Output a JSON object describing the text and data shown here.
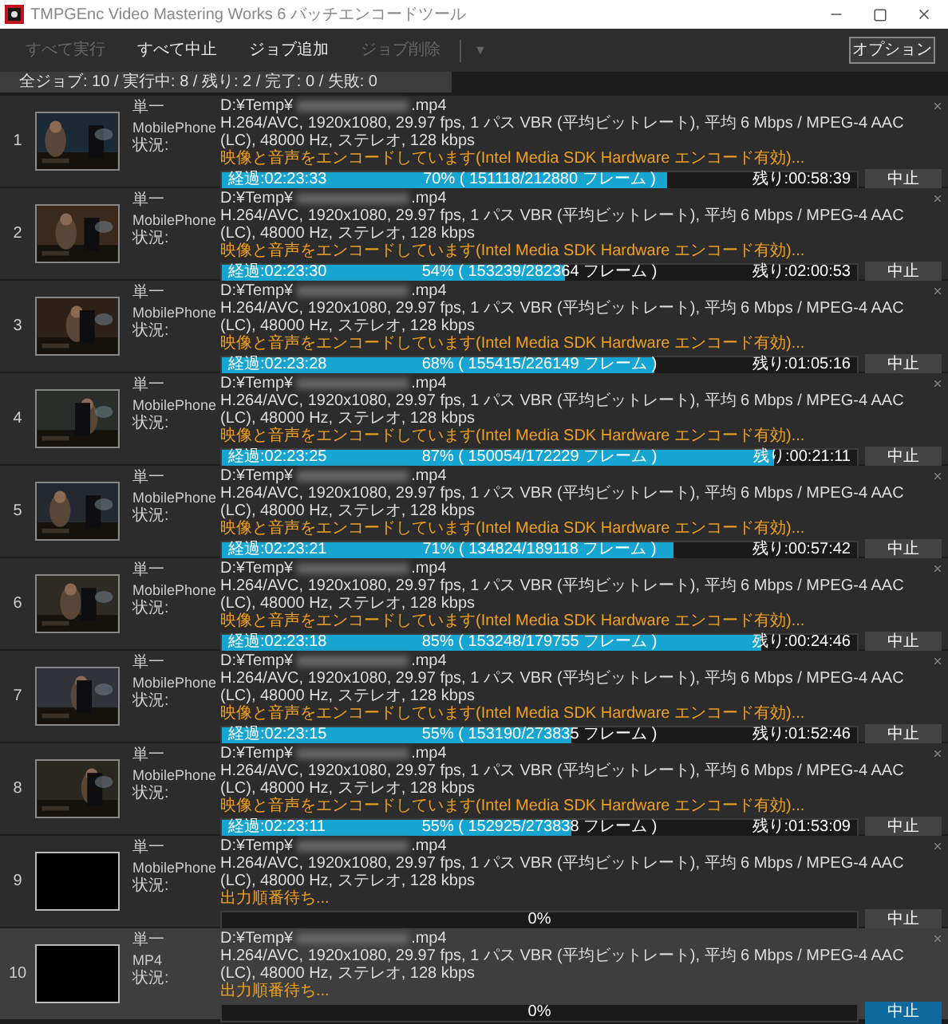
{
  "window": {
    "title": "TMPGEnc Video Mastering Works 6 バッチエンコードツール"
  },
  "toolbar": {
    "buttons": [
      {
        "label": "すべて実行",
        "disabled": true
      },
      {
        "label": "すべて中止",
        "disabled": false
      },
      {
        "label": "ジョブ追加",
        "disabled": false
      },
      {
        "label": "ジョブ削除",
        "disabled": true
      }
    ],
    "dropdown": {
      "label": "▼",
      "disabled": true
    },
    "options_button": "オプション"
  },
  "summary": "全ジョブ: 10 / 実行中: 8 / 残り: 2 / 完了: 0 / 失敗: 0",
  "jobs": [
    {
      "number": "1",
      "has_thumbnail": true,
      "mode": "単一",
      "format": "MobilePhone",
      "status_label": "状況:",
      "path_prefix": "D:¥Temp¥",
      "path_suffix": ".mp4",
      "spec": "H.264/AVC, 1920x1080, 29.97 fps, 1 パス VBR (平均ビットレート), 平均 6 Mbps / MPEG-4 AAC (LC), 48000 Hz, ステレオ, 128 kbps",
      "status": "映像と音声をエンコードしています(Intel Media SDK Hardware エンコード有効)...",
      "elapsed": "経過:02:23:33",
      "progress": "70% ( 151118/212880 フレーム )",
      "level": 0.7,
      "remaining": "残り:00:58:39",
      "stop": "中止",
      "selected": false
    },
    {
      "number": "2",
      "has_thumbnail": true,
      "mode": "単一",
      "format": "MobilePhone",
      "status_label": "状況:",
      "path_prefix": "D:¥Temp¥",
      "path_suffix": ".mp4",
      "spec": "H.264/AVC, 1920x1080, 29.97 fps, 1 パス VBR (平均ビットレート), 平均 6 Mbps / MPEG-4 AAC (LC), 48000 Hz, ステレオ, 128 kbps",
      "status": "映像と音声をエンコードしています(Intel Media SDK Hardware エンコード有効)...",
      "elapsed": "経過:02:23:30",
      "progress": "54% ( 153239/282364 フレーム )",
      "level": 0.54,
      "remaining": "残り:02:00:53",
      "stop": "中止",
      "selected": false
    },
    {
      "number": "3",
      "has_thumbnail": true,
      "mode": "単一",
      "format": "MobilePhone",
      "status_label": "状況:",
      "path_prefix": "D:¥Temp¥",
      "path_suffix": ".mp4",
      "spec": "H.264/AVC, 1920x1080, 29.97 fps, 1 パス VBR (平均ビットレート), 平均 6 Mbps / MPEG-4 AAC (LC), 48000 Hz, ステレオ, 128 kbps",
      "status": "映像と音声をエンコードしています(Intel Media SDK Hardware エンコード有効)...",
      "elapsed": "経過:02:23:28",
      "progress": "68% ( 155415/226149 フレーム )",
      "level": 0.68,
      "remaining": "残り:01:05:16",
      "stop": "中止",
      "selected": false
    },
    {
      "number": "4",
      "has_thumbnail": true,
      "mode": "単一",
      "format": "MobilePhone",
      "status_label": "状況:",
      "path_prefix": "D:¥Temp¥",
      "path_suffix": ".mp4",
      "spec": "H.264/AVC, 1920x1080, 29.97 fps, 1 パス VBR (平均ビットレート), 平均 6 Mbps / MPEG-4 AAC (LC), 48000 Hz, ステレオ, 128 kbps",
      "status": "映像と音声をエンコードしています(Intel Media SDK Hardware エンコード有効)...",
      "elapsed": "経過:02:23:25",
      "progress": "87% ( 150054/172229 フレーム )",
      "level": 0.87,
      "remaining": "残り:00:21:11",
      "stop": "中止",
      "selected": false
    },
    {
      "number": "5",
      "has_thumbnail": true,
      "mode": "単一",
      "format": "MobilePhone",
      "status_label": "状況:",
      "path_prefix": "D:¥Temp¥",
      "path_suffix": ".mp4",
      "spec": "H.264/AVC, 1920x1080, 29.97 fps, 1 パス VBR (平均ビットレート), 平均 6 Mbps / MPEG-4 AAC (LC), 48000 Hz, ステレオ, 128 kbps",
      "status": "映像と音声をエンコードしています(Intel Media SDK Hardware エンコード有効)...",
      "elapsed": "経過:02:23:21",
      "progress": "71% ( 134824/189118 フレーム )",
      "level": 0.71,
      "remaining": "残り:00:57:42",
      "stop": "中止",
      "selected": false
    },
    {
      "number": "6",
      "has_thumbnail": true,
      "mode": "単一",
      "format": "MobilePhone",
      "status_label": "状況:",
      "path_prefix": "D:¥Temp¥",
      "path_suffix": ".mp4",
      "spec": "H.264/AVC, 1920x1080, 29.97 fps, 1 パス VBR (平均ビットレート), 平均 6 Mbps / MPEG-4 AAC (LC), 48000 Hz, ステレオ, 128 kbps",
      "status": "映像と音声をエンコードしています(Intel Media SDK Hardware エンコード有効)...",
      "elapsed": "経過:02:23:18",
      "progress": "85% ( 153248/179755 フレーム )",
      "level": 0.85,
      "remaining": "残り:00:24:46",
      "stop": "中止",
      "selected": false
    },
    {
      "number": "7",
      "has_thumbnail": true,
      "mode": "単一",
      "format": "MobilePhone",
      "status_label": "状況:",
      "path_prefix": "D:¥Temp¥",
      "path_suffix": ".mp4",
      "spec": "H.264/AVC, 1920x1080, 29.97 fps, 1 パス VBR (平均ビットレート), 平均 6 Mbps / MPEG-4 AAC (LC), 48000 Hz, ステレオ, 128 kbps",
      "status": "映像と音声をエンコードしています(Intel Media SDK Hardware エンコード有効)...",
      "elapsed": "経過:02:23:15",
      "progress": "55% ( 153190/273835 フレーム )",
      "level": 0.55,
      "remaining": "残り:01:52:46",
      "stop": "中止",
      "selected": false
    },
    {
      "number": "8",
      "has_thumbnail": true,
      "mode": "単一",
      "format": "MobilePhone",
      "status_label": "状況:",
      "path_prefix": "D:¥Temp¥",
      "path_suffix": ".mp4",
      "spec": "H.264/AVC, 1920x1080, 29.97 fps, 1 パス VBR (平均ビットレート), 平均 6 Mbps / MPEG-4 AAC (LC), 48000 Hz, ステレオ, 128 kbps",
      "status": "映像と音声をエンコードしています(Intel Media SDK Hardware エンコード有効)...",
      "elapsed": "経過:02:23:11",
      "progress": "55% ( 152925/273838 フレーム )",
      "level": 0.55,
      "remaining": "残り:01:53:09",
      "stop": "中止",
      "selected": false
    },
    {
      "number": "9",
      "has_thumbnail": false,
      "mode": "単一",
      "format": "MobilePhone",
      "status_label": "状況:",
      "path_prefix": "D:¥Temp¥",
      "path_suffix": ".mp4",
      "spec": "H.264/AVC, 1920x1080, 29.97 fps, 1 パス VBR (平均ビットレート), 平均 6 Mbps / MPEG-4 AAC (LC), 48000 Hz, ステレオ, 128 kbps",
      "status": "出力順番待ち...",
      "progress": "0%",
      "level": 0,
      "stop": "中止",
      "selected": false
    },
    {
      "number": "10",
      "has_thumbnail": false,
      "mode": "単一",
      "format": "MP4",
      "status_label": "状況:",
      "path_prefix": "D:¥Temp¥",
      "path_suffix": ".mp4",
      "spec": "H.264/AVC, 1920x1080, 29.97 fps, 1 パス VBR (平均ビットレート), 平均 6 Mbps / MPEG-4 AAC (LC), 48000 Hz, ステレオ, 128 kbps",
      "status": "出力順番待ち...",
      "progress": "0%",
      "level": 0,
      "stop": "中止",
      "selected": true
    }
  ]
}
